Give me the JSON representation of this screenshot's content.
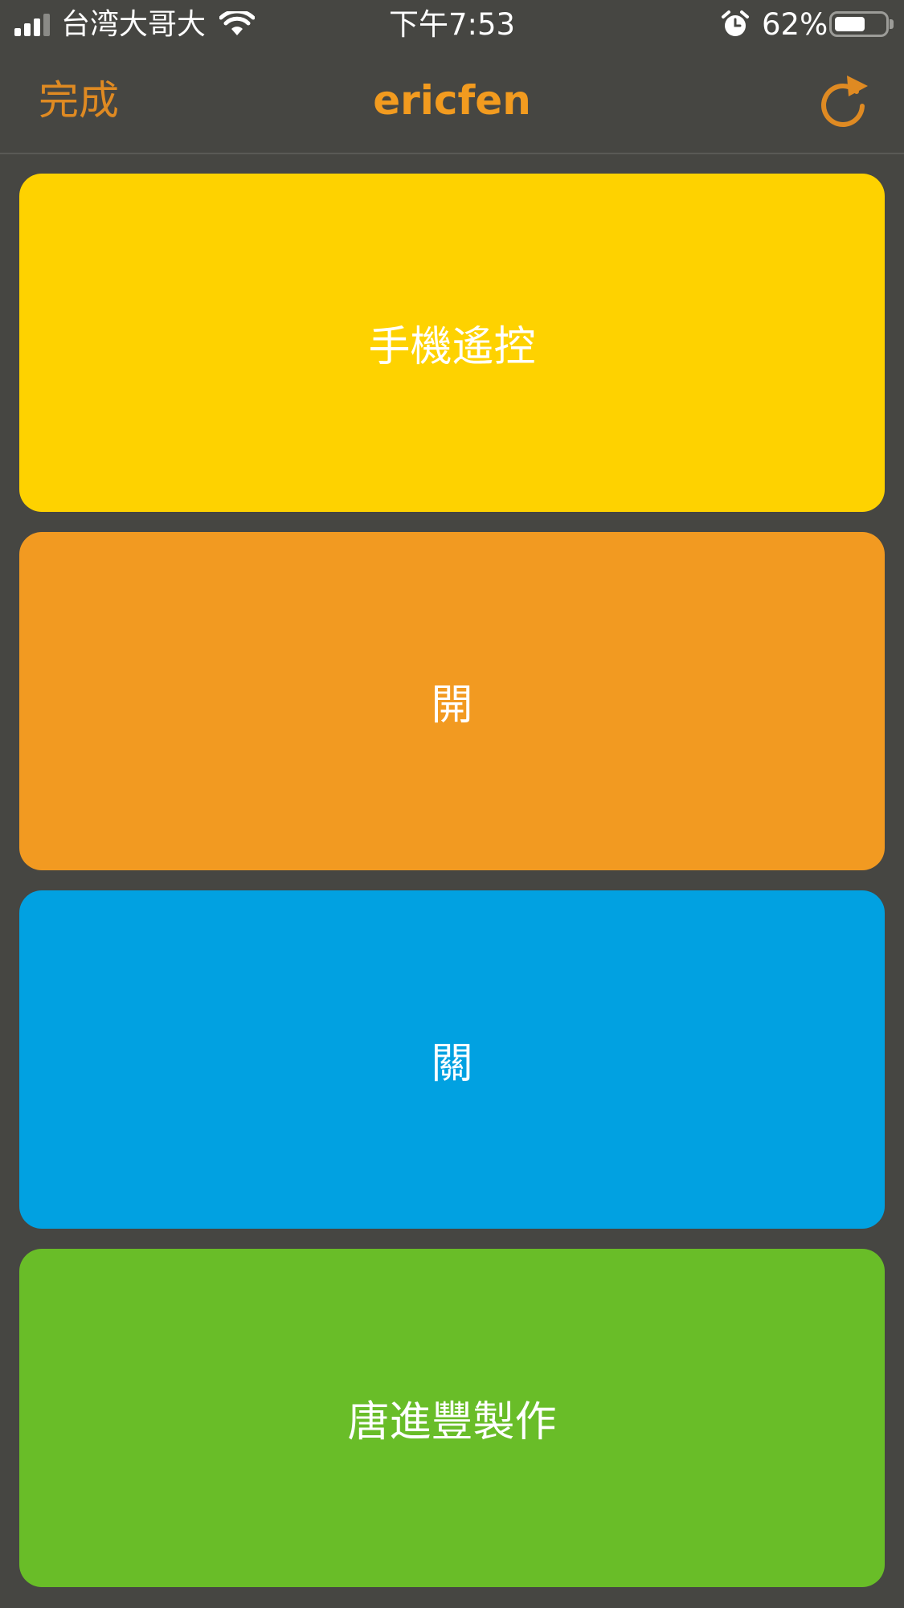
{
  "status_bar": {
    "carrier": "台湾大哥大",
    "time": "下午7:53",
    "battery_percent": "62%",
    "battery_level": 0.62,
    "icons": [
      "signal-icon",
      "wifi-icon",
      "alarm-icon",
      "battery-icon"
    ]
  },
  "nav": {
    "done_label": "完成",
    "title": "ericfen",
    "refresh_icon": "refresh-icon",
    "accent_color": "#f29b1f"
  },
  "tiles": [
    {
      "label": "手機遙控",
      "color": "#fed200"
    },
    {
      "label": "開",
      "color": "#f29a21"
    },
    {
      "label": "關",
      "color": "#01a1e1"
    },
    {
      "label": "唐進豐製作",
      "color": "#69bd28"
    }
  ]
}
